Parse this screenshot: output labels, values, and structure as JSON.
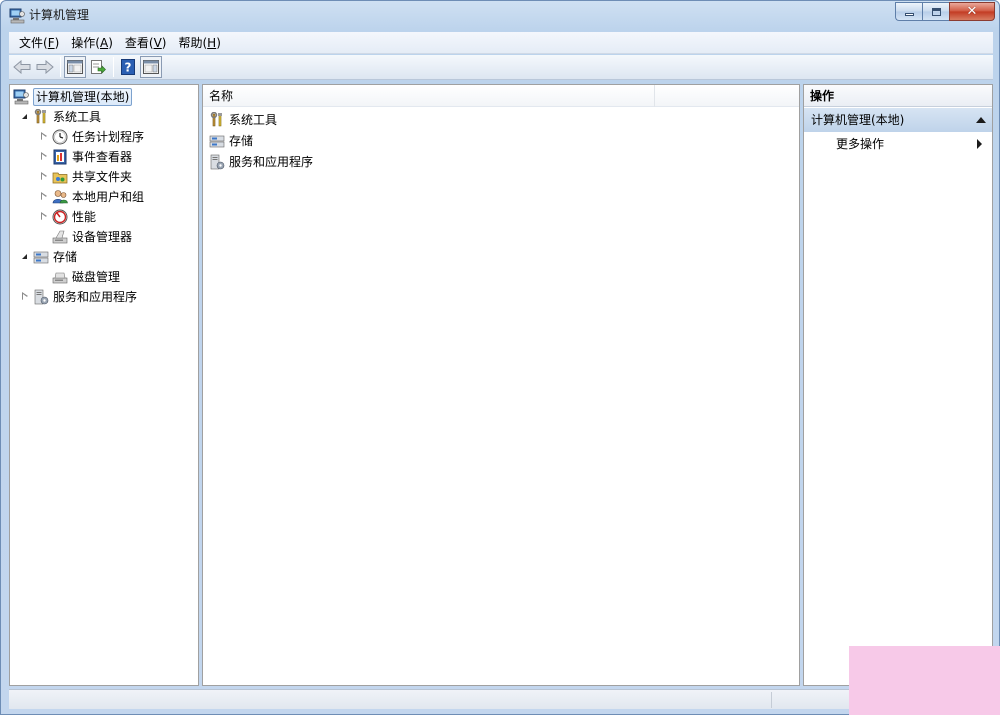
{
  "window": {
    "title": "计算机管理"
  },
  "menu": [
    {
      "label": "文件(",
      "acc": "F",
      "suffix": ")"
    },
    {
      "label": "操作(",
      "acc": "A",
      "suffix": ")"
    },
    {
      "label": "查看(",
      "acc": "V",
      "suffix": ")"
    },
    {
      "label": "帮助(",
      "acc": "H",
      "suffix": ")"
    }
  ],
  "tree": [
    {
      "label": "计算机管理(本地)",
      "icon": "computer-management-icon"
    },
    {
      "label": "系统工具",
      "icon": "system-tools-icon"
    },
    {
      "label": "任务计划程序",
      "icon": "task-scheduler-icon"
    },
    {
      "label": "事件查看器",
      "icon": "event-viewer-icon"
    },
    {
      "label": "共享文件夹",
      "icon": "shared-folders-icon"
    },
    {
      "label": "本地用户和组",
      "icon": "local-users-icon"
    },
    {
      "label": "性能",
      "icon": "performance-icon"
    },
    {
      "label": "设备管理器",
      "icon": "device-manager-icon"
    },
    {
      "label": "存储",
      "icon": "storage-icon"
    },
    {
      "label": "磁盘管理",
      "icon": "disk-management-icon"
    },
    {
      "label": "服务和应用程序",
      "icon": "services-apps-icon"
    }
  ],
  "list": {
    "column_name": "名称",
    "items": [
      {
        "label": "系统工具",
        "icon": "system-tools-icon"
      },
      {
        "label": "存储",
        "icon": "storage-icon"
      },
      {
        "label": "服务和应用程序",
        "icon": "services-apps-icon"
      }
    ]
  },
  "actions": {
    "header": "操作",
    "group": "计算机管理(本地)",
    "item": "更多操作"
  }
}
